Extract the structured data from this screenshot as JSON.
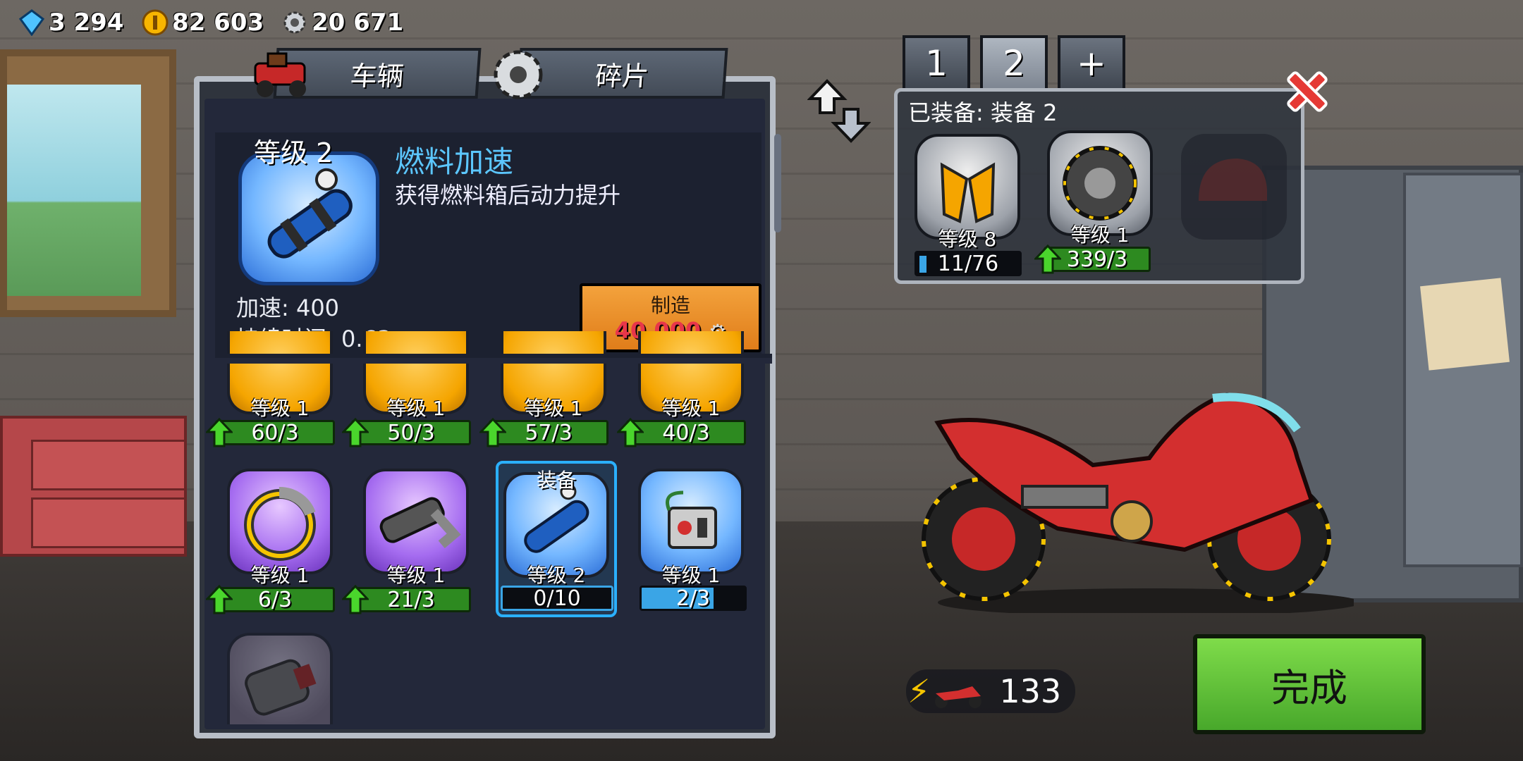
{
  "currency": {
    "gems": "3 294",
    "coins": "82 603",
    "gears": "20 671"
  },
  "tabs": {
    "vehicles": "车辆",
    "parts": "碎片"
  },
  "selected_part": {
    "level": "等级 2",
    "name": "燃料加速",
    "description": "获得燃料箱后动力提升",
    "stat1": "加速: 400",
    "stat2": "持续时间: 0.63",
    "craft_label": "制造",
    "craft_cost": "40 000"
  },
  "grid": {
    "row1": [
      {
        "level": "等级 1",
        "progress": "60/3"
      },
      {
        "level": "等级 1",
        "progress": "50/3"
      },
      {
        "level": "等级 1",
        "progress": "57/3"
      },
      {
        "level": "等级 1",
        "progress": "40/3"
      }
    ],
    "row2": [
      {
        "level": "等级 1",
        "progress": "6/3"
      },
      {
        "level": "等级 1",
        "progress": "21/3"
      },
      {
        "level": "等级 2",
        "progress": "0/10",
        "tag": "装备"
      },
      {
        "level": "等级 1",
        "progress": "2/3"
      }
    ]
  },
  "loadout": {
    "slots": [
      "1",
      "2",
      "+"
    ],
    "title": "已装备: 装备 2",
    "items": [
      {
        "level": "等级 8",
        "progress": "11/76"
      },
      {
        "level": "等级 1",
        "progress": "339/3"
      }
    ]
  },
  "power": "133",
  "done_label": "完成",
  "colors": {
    "accent_blue": "#5cc7ff",
    "progress_green": "#2d8a20",
    "craft_orange": "#f3a23c",
    "done_green": "#48a82b"
  }
}
